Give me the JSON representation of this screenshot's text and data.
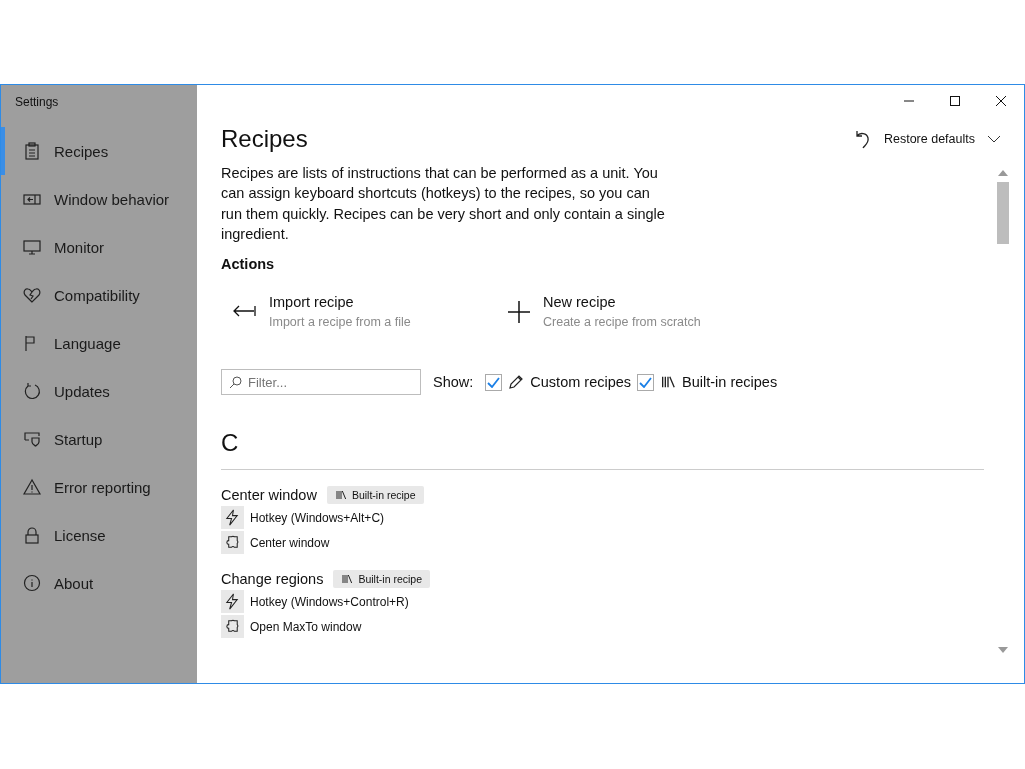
{
  "window": {
    "title": "Settings"
  },
  "sidebar": {
    "items": [
      {
        "label": "Recipes",
        "selected": true
      },
      {
        "label": "Window behavior",
        "selected": false
      },
      {
        "label": "Monitor",
        "selected": false
      },
      {
        "label": "Compatibility",
        "selected": false
      },
      {
        "label": "Language",
        "selected": false
      },
      {
        "label": "Updates",
        "selected": false
      },
      {
        "label": "Startup",
        "selected": false
      },
      {
        "label": "Error reporting",
        "selected": false
      },
      {
        "label": "License",
        "selected": false
      },
      {
        "label": "About",
        "selected": false
      }
    ]
  },
  "page": {
    "title": "Recipes",
    "restore_button": "Restore defaults",
    "description": "Recipes are lists of instructions that can be performed as a unit. You can assign keyboard shortcuts (hotkeys) to the recipes, so you can run them quickly. Recipes can be very short and only contain a single ingredient.",
    "actions_heading": "Actions",
    "actions": [
      {
        "kind": "import",
        "title": "Import recipe",
        "subtitle": "Import a recipe from a file"
      },
      {
        "kind": "new",
        "title": "New recipe",
        "subtitle": "Create a recipe from scratch"
      }
    ],
    "filter": {
      "placeholder": "Filter...",
      "show_label": "Show:",
      "options": [
        {
          "kind": "custom",
          "label": "Custom recipes",
          "checked": true
        },
        {
          "kind": "builtin",
          "label": "Built-in recipes",
          "checked": true
        }
      ]
    },
    "groups": [
      {
        "letter": "C",
        "recipes": [
          {
            "name": "Center window",
            "badge": "Built-in recipe",
            "steps": [
              {
                "kind": "hotkey",
                "text": "Hotkey (Windows+Alt+C)"
              },
              {
                "kind": "action",
                "text": "Center window"
              }
            ]
          },
          {
            "name": "Change regions",
            "badge": "Built-in recipe",
            "steps": [
              {
                "kind": "hotkey",
                "text": "Hotkey (Windows+Control+R)"
              },
              {
                "kind": "action",
                "text": "Open MaxTo window"
              }
            ]
          }
        ]
      }
    ]
  }
}
